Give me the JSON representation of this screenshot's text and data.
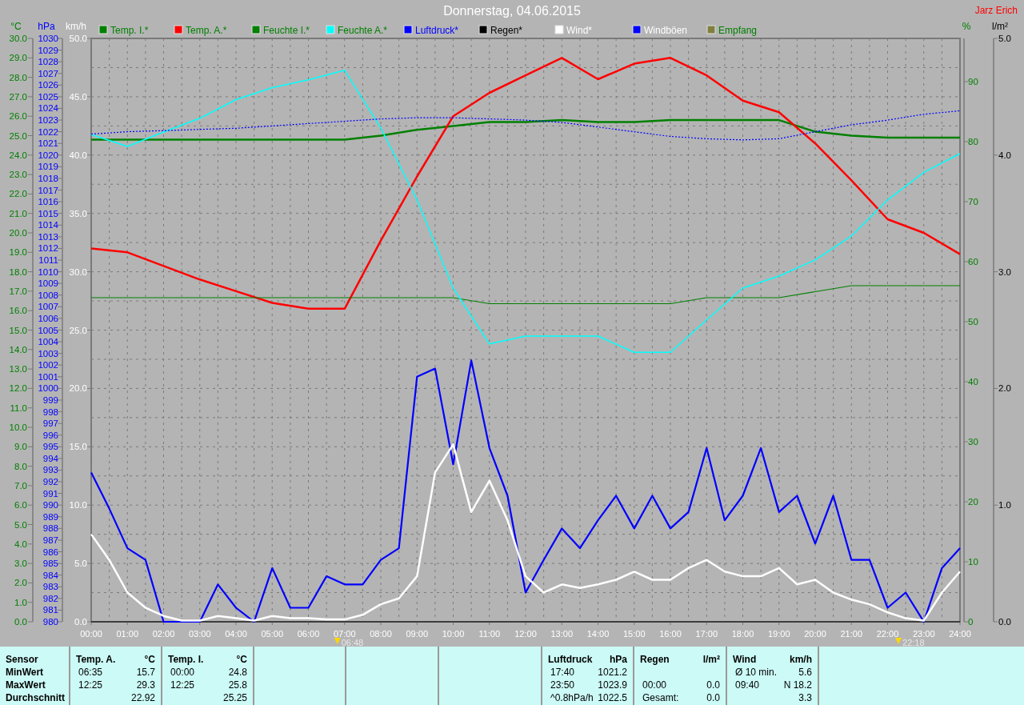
{
  "header": {
    "title": "Donnerstag, 04.06.2015",
    "author": "Jarz Erich"
  },
  "temperature_humidity_chart": {
    "chart_data": {
      "type": "line",
      "grid": true,
      "legend": "top",
      "ylabel": "°C",
      "y2label": "%",
      "y3label": "l/m²",
      "xlim": [
        0,
        24
      ],
      "ylim": [
        0,
        30
      ],
      "y2lim": [
        0,
        97.2
      ],
      "y3lim": [
        0,
        5
      ],
      "xticks": [
        {
          "value": 0,
          "label": "00:00"
        },
        {
          "value": 1,
          "label": "01:00"
        },
        {
          "value": 2,
          "label": "02:00"
        },
        {
          "value": 3,
          "label": "03:00"
        },
        {
          "value": 4,
          "label": "04:00"
        },
        {
          "value": 5,
          "label": "05:00"
        },
        {
          "value": 6,
          "label": "06:00"
        },
        {
          "value": 7,
          "label": "07:00"
        },
        {
          "value": 8,
          "label": "08:00"
        },
        {
          "value": 9,
          "label": "09:00"
        },
        {
          "value": 10,
          "label": "10:00"
        },
        {
          "value": 11,
          "label": "11:00"
        },
        {
          "value": 12,
          "label": "12:00"
        },
        {
          "value": 13,
          "label": "13:00"
        },
        {
          "value": 14,
          "label": "14:00"
        },
        {
          "value": 15,
          "label": "15:00"
        },
        {
          "value": 16,
          "label": "16:00"
        },
        {
          "value": 17,
          "label": "17:00"
        },
        {
          "value": 18,
          "label": "18:00"
        },
        {
          "value": 19,
          "label": "19:00"
        },
        {
          "value": 20,
          "label": "20:00"
        },
        {
          "value": 21,
          "label": "21:00"
        },
        {
          "value": 22,
          "label": "22:00"
        },
        {
          "value": 23,
          "label": "23:00"
        },
        {
          "value": 24,
          "label": "24:00"
        }
      ],
      "yticks": [
        {
          "value": 0,
          "label": "0.0"
        },
        {
          "value": 1,
          "label": "1.0"
        },
        {
          "value": 2,
          "label": "2.0"
        },
        {
          "value": 3,
          "label": "3.0"
        },
        {
          "value": 4,
          "label": "4.0"
        },
        {
          "value": 5,
          "label": "5.0"
        },
        {
          "value": 6,
          "label": "6.0"
        },
        {
          "value": 7,
          "label": "7.0"
        },
        {
          "value": 8,
          "label": "8.0"
        },
        {
          "value": 9,
          "label": "9.0"
        },
        {
          "value": 10,
          "label": "10.0"
        },
        {
          "value": 11,
          "label": "11.0"
        },
        {
          "value": 12,
          "label": "12.0"
        },
        {
          "value": 13,
          "label": "13.0"
        },
        {
          "value": 14,
          "label": "14.0"
        },
        {
          "value": 15,
          "label": "15.0"
        },
        {
          "value": 16,
          "label": "16.0"
        },
        {
          "value": 17,
          "label": "17.0"
        },
        {
          "value": 18,
          "label": "18.0"
        },
        {
          "value": 19,
          "label": "19.0"
        },
        {
          "value": 20,
          "label": "20.0"
        },
        {
          "value": 21,
          "label": "21.0"
        },
        {
          "value": 22,
          "label": "22.0"
        },
        {
          "value": 23,
          "label": "23.0"
        },
        {
          "value": 24,
          "label": "24.0"
        },
        {
          "value": 25,
          "label": "25.0"
        },
        {
          "value": 26,
          "label": "26.0"
        },
        {
          "value": 27,
          "label": "27.0"
        },
        {
          "value": 28,
          "label": "28.0"
        },
        {
          "value": 29,
          "label": "29.0"
        },
        {
          "value": 30,
          "label": "30.0"
        }
      ],
      "y2ticks": [
        0,
        10,
        20,
        30,
        40,
        50,
        60,
        70,
        80,
        90
      ],
      "y3ticks": [
        {
          "value": 0,
          "label": "0.0"
        },
        {
          "value": 1,
          "label": "1.0"
        },
        {
          "value": 2,
          "label": "2.0"
        },
        {
          "value": 3,
          "label": "3.0"
        },
        {
          "value": 4,
          "label": "4.0"
        },
        {
          "value": 5,
          "label": "5.0"
        }
      ],
      "x": [
        0,
        1,
        2,
        3,
        4,
        5,
        6,
        7,
        8,
        9,
        10,
        11,
        12,
        13,
        14,
        15,
        16,
        17,
        18,
        19,
        20,
        21,
        22,
        23,
        24
      ],
      "series": [
        {
          "name": "Temp. I.*",
          "color": "#008000",
          "values": [
            24.8,
            24.8,
            24.8,
            24.8,
            24.8,
            24.8,
            24.8,
            24.8,
            25.0,
            25.3,
            25.5,
            25.7,
            25.7,
            25.8,
            25.7,
            25.7,
            25.8,
            25.8,
            25.8,
            25.8,
            25.2,
            25.0,
            24.9,
            24.9,
            24.9
          ]
        },
        {
          "name": "Temp. A.*",
          "color": "#ff0000",
          "values": [
            19.2,
            19.0,
            18.3,
            17.6,
            17.0,
            16.4,
            16.1,
            16.1,
            19.6,
            22.9,
            26.0,
            27.2,
            28.1,
            29.0,
            27.9,
            28.7,
            29.0,
            28.1,
            26.8,
            26.2,
            24.6,
            22.7,
            20.7,
            20.0,
            18.9
          ]
        },
        {
          "name": "Feuchte I.*",
          "color": "#008000",
          "axis": "y2",
          "values": [
            54,
            54,
            54,
            54,
            54,
            54,
            54,
            54,
            54,
            54,
            54,
            53,
            53,
            53,
            53,
            53,
            53,
            54,
            54,
            54,
            55,
            56,
            56,
            56,
            56
          ]
        },
        {
          "name": "Feuchte A.*",
          "color": "#00ffff",
          "axis": "y2",
          "values": [
            81.2,
            79.2,
            81.6,
            83.9,
            87,
            89,
            90.3,
            91.9,
            82.3,
            70.3,
            55.6,
            46.3,
            47.6,
            47.6,
            47.6,
            44.9,
            44.9,
            50.3,
            55.6,
            57.6,
            60.3,
            64.3,
            70.3,
            74.9,
            78
          ]
        },
        {
          "name": "Regen*",
          "color": "#000000",
          "axis": "y3",
          "values": [
            0,
            0,
            0,
            0,
            0,
            0,
            0,
            0,
            0,
            0,
            0,
            0,
            0,
            0,
            0,
            0,
            0,
            0,
            0,
            0,
            0,
            0,
            0,
            0,
            0
          ]
        },
        {
          "name": "Empfang",
          "color": "#808040",
          "axis": "y2",
          "values": [
            null,
            null,
            null,
            null,
            null,
            null,
            null,
            null,
            null,
            null,
            null,
            null,
            null,
            null,
            null,
            null,
            null,
            null,
            null,
            null,
            null,
            null,
            null,
            null,
            null
          ]
        }
      ],
      "annotations": [
        "06:48",
        "22:18"
      ]
    }
  },
  "pressure_wind_chart": {
    "chart_data": {
      "type": "line",
      "ylabel": "km/h",
      "y2label": "hPa",
      "xlim": [
        0,
        24
      ],
      "ylim": [
        0,
        50
      ],
      "y2lim": [
        980,
        1030
      ],
      "yticks": [
        {
          "value": 0,
          "label": "0.0"
        },
        {
          "value": 5,
          "label": "5.0"
        },
        {
          "value": 10,
          "label": "10.0"
        },
        {
          "value": 15,
          "label": "15.0"
        },
        {
          "value": 20,
          "label": "20.0"
        },
        {
          "value": 25,
          "label": "25.0"
        },
        {
          "value": 30,
          "label": "30.0"
        },
        {
          "value": 35,
          "label": "35.0"
        },
        {
          "value": 40,
          "label": "40.0"
        },
        {
          "value": 45,
          "label": "45.0"
        },
        {
          "value": 50,
          "label": "50.0"
        }
      ],
      "y2ticks": [
        980,
        981,
        982,
        983,
        984,
        985,
        986,
        987,
        988,
        989,
        990,
        991,
        992,
        993,
        994,
        995,
        996,
        997,
        998,
        999,
        1000,
        1001,
        1002,
        1003,
        1004,
        1005,
        1006,
        1007,
        1008,
        1009,
        1010,
        1011,
        1012,
        1013,
        1014,
        1015,
        1016,
        1017,
        1018,
        1019,
        1020,
        1021,
        1022,
        1023,
        1024,
        1025,
        1026,
        1027,
        1028,
        1029,
        1030
      ],
      "x": [
        0,
        0.5,
        1,
        1.5,
        2,
        2.5,
        3,
        3.5,
        4,
        4.5,
        5,
        5.5,
        6,
        6.5,
        7,
        7.5,
        8,
        8.5,
        9,
        9.5,
        10,
        10.5,
        11,
        11.5,
        12,
        12.5,
        13,
        13.5,
        14,
        14.5,
        15,
        15.5,
        16,
        16.5,
        17,
        17.5,
        18,
        18.5,
        19,
        19.5,
        20,
        20.5,
        21,
        21.5,
        22,
        22.5,
        23,
        23.5,
        24
      ],
      "series": [
        {
          "name": "Luftdruck*",
          "color": "#0000ff",
          "axis": "y2",
          "line_style": "dotted",
          "values": [
            1021.8,
            1021.9,
            1022.0,
            1022.05,
            1022.1,
            1022.15,
            1022.2,
            1022.25,
            1022.3,
            1022.4,
            1022.5,
            1022.6,
            1022.7,
            1022.8,
            1022.9,
            1023.0,
            1023.1,
            1023.15,
            1023.2,
            1023.2,
            1023.2,
            1023.15,
            1023.1,
            1023.05,
            1023.0,
            1022.9,
            1022.8,
            1022.6,
            1022.4,
            1022.2,
            1022.0,
            1021.8,
            1021.6,
            1021.5,
            1021.4,
            1021.35,
            1021.3,
            1021.35,
            1021.4,
            1021.7,
            1022.0,
            1022.3,
            1022.6,
            1022.8,
            1023.0,
            1023.25,
            1023.5,
            1023.65,
            1023.8
          ]
        },
        {
          "name": "Windböen",
          "color": "#0000ff",
          "values": [
            12.8,
            9.7,
            6.3,
            5.3,
            0,
            0,
            0,
            3.2,
            1.2,
            0,
            4.6,
            1.2,
            1.2,
            3.9,
            3.2,
            3.2,
            5.3,
            6.3,
            21,
            21.7,
            13.5,
            22.4,
            14.9,
            10.8,
            2.5,
            5.3,
            8,
            6.3,
            8.7,
            10.8,
            8,
            10.8,
            8,
            9.4,
            14.9,
            8.7,
            10.8,
            14.9,
            9.4,
            10.8,
            6.7,
            10.8,
            5.3,
            5.3,
            1.2,
            2.5,
            0,
            4.6,
            6.3
          ]
        },
        {
          "name": "Wind*",
          "color": "#ffffff",
          "values": [
            7.5,
            5.3,
            2.5,
            1.2,
            0.5,
            0.1,
            0.1,
            0.5,
            0.3,
            0.1,
            0.5,
            0.3,
            0.3,
            0.2,
            0.2,
            0.6,
            1.5,
            2,
            3.9,
            12.8,
            15.2,
            9.4,
            12.1,
            8.7,
            3.9,
            2.5,
            3.2,
            2.9,
            3.2,
            3.6,
            4.3,
            3.6,
            3.6,
            4.6,
            5.3,
            4.3,
            3.9,
            3.9,
            4.6,
            3.2,
            3.6,
            2.5,
            1.9,
            1.5,
            0.8,
            0.3,
            0.1,
            2.5,
            4.3
          ]
        }
      ]
    }
  },
  "stats_panel": [
    {
      "header": [
        "Sensor"
      ],
      "rows": [
        {
          "label": "MinWert"
        },
        {
          "label": "MaxWert"
        },
        {
          "label": "Durchschnitt"
        }
      ],
      "kind": "labels"
    },
    {
      "header": [
        "Temp. A.",
        "°C"
      ],
      "rows": [
        {
          "time": "06:35",
          "value": "15.7"
        },
        {
          "time": "12:25",
          "value": "29.3"
        },
        {
          "value": "22.92"
        }
      ],
      "kind": "values"
    },
    {
      "header": [
        "Temp. I.",
        "°C"
      ],
      "rows": [
        {
          "time": "00:00",
          "value": "24.8"
        },
        {
          "time": "12:25",
          "value": "25.8"
        },
        {
          "value": "25.25"
        }
      ],
      "kind": "values"
    },
    {
      "kind": "empty"
    },
    {
      "kind": "empty"
    },
    {
      "kind": "empty"
    },
    {
      "header": [
        "Luftdruck",
        "hPa"
      ],
      "rows": [
        {
          "time": "17:40",
          "value": "1021.2"
        },
        {
          "time": "23:50",
          "value": "1023.9"
        },
        {
          "time": "^0.8hPa/h",
          "value": "1022.5"
        }
      ],
      "kind": "values"
    },
    {
      "header": [
        "Regen",
        "l/m²"
      ],
      "rows": [
        {},
        {
          "time": "00:00",
          "value": "0.0"
        },
        {
          "time": "Gesamt:",
          "value": "0.0"
        }
      ],
      "kind": "values"
    },
    {
      "header": [
        "Wind",
        "km/h"
      ],
      "rows": [
        {
          "time": "Ø 10 min.",
          "value": "5.6"
        },
        {
          "time": "09:40",
          "value": "N 18.2"
        },
        {
          "value": "3.3"
        }
      ],
      "kind": "values"
    }
  ]
}
